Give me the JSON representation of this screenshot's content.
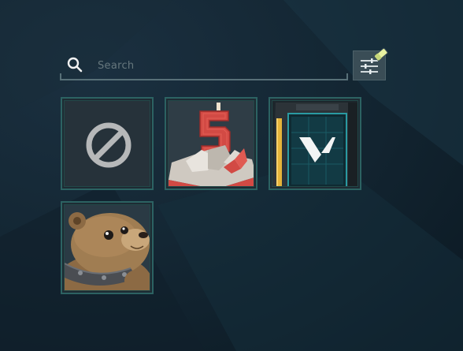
{
  "search": {
    "placeholder": "Search",
    "value": ""
  },
  "icons": {
    "search": "search-icon",
    "filter": "sliders-icon",
    "filter_badge": "eraser-icon",
    "none": "prohibited-icon"
  },
  "colors": {
    "background": "#142734",
    "tile_border": "#2c6262",
    "tile_fill": "#1e2b33",
    "filter_button": "#3a4d56",
    "filter_badge": "#e8f2a0",
    "accent_red": "#d24a44",
    "accent_teal": "#2a9aa2",
    "accent_gold": "#e6b43a"
  },
  "tiles": [
    {
      "name": "none",
      "icon": "prohibited-icon"
    },
    {
      "name": "birthday-cake-5",
      "icon": "cake-candle-5-icon"
    },
    {
      "name": "valorant-device",
      "icon": "v-device-icon"
    },
    {
      "name": "armored-bear",
      "icon": "bear-icon"
    }
  ]
}
